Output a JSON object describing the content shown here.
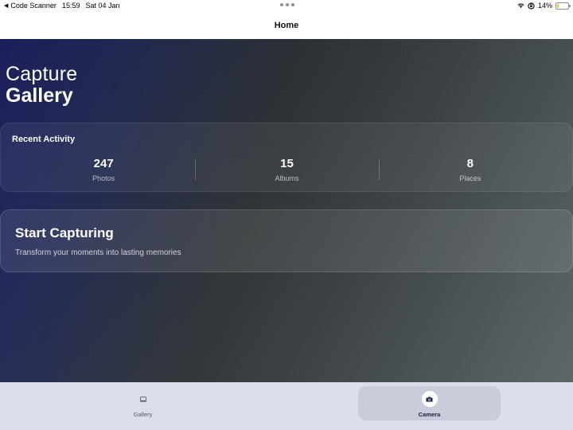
{
  "status_bar": {
    "app_name": "Code Scanner",
    "time": "15:59",
    "date": "Sat 04 Jan",
    "battery": "14%",
    "battery_level": 0.14,
    "battery_color": "#f4c20d"
  },
  "nav": {
    "title": "Home"
  },
  "hero": {
    "line1": "Capture",
    "line2": "Gallery"
  },
  "recent_activity": {
    "title": "Recent Activity",
    "stats": [
      {
        "value": "247",
        "label": "Photos"
      },
      {
        "value": "15",
        "label": "Albums"
      },
      {
        "value": "8",
        "label": "Places"
      }
    ]
  },
  "start_capturing": {
    "title": "Start Capturing",
    "subtitle": "Transform your moments into lasting memories"
  },
  "tabs": [
    {
      "label": "Gallery",
      "icon": "gallery-icon",
      "selected": false
    },
    {
      "label": "Camera",
      "icon": "camera-icon",
      "selected": true
    }
  ],
  "colors": {
    "accent_dark": "#1e2340",
    "tab_bar_bg": "#dcdfea",
    "selected_tab_bg": "#c9ccda"
  }
}
